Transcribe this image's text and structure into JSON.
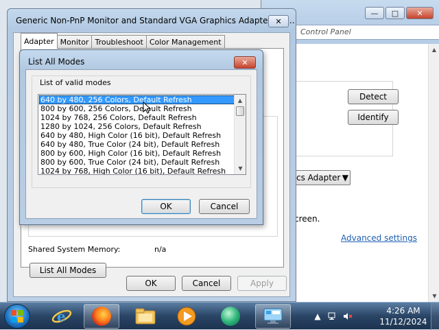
{
  "control_panel": {
    "address": "Control Panel",
    "detect_label": "Detect",
    "identify_label": "Identify",
    "adapter_select_value": "cs Adapter",
    "screen_text": "creen.",
    "advanced_link": "Advanced settings"
  },
  "properties": {
    "title": "Generic Non-PnP Monitor and Standard VGA Graphics Adapter Pro...",
    "close_label": "✕",
    "tabs": [
      {
        "label": "Adapter"
      },
      {
        "label": "Monitor"
      },
      {
        "label": "Troubleshoot"
      },
      {
        "label": "Color Management"
      }
    ],
    "shared_memory_label": "Shared System Memory:",
    "shared_memory_value": "n/a",
    "list_all_modes_label": "List All Modes",
    "ok_label": "OK",
    "cancel_label": "Cancel",
    "apply_label": "Apply"
  },
  "modes_dialog": {
    "title": "List All Modes",
    "close_label": "✕",
    "group_label": "List of valid modes",
    "modes": [
      "640 by 480, 256 Colors, Default Refresh",
      "800 by 600, 256 Colors, Default Refresh",
      "1024 by 768, 256 Colors, Default Refresh",
      "1280 by 1024, 256 Colors, Default Refresh",
      "640 by 480, High Color (16 bit), Default Refresh",
      "640 by 480, True Color (24 bit), Default Refresh",
      "800 by 600, High Color (16 bit), Default Refresh",
      "800 by 600, True Color (24 bit), Default Refresh",
      "1024 by 768, High Color (16 bit), Default Refresh"
    ],
    "ok_label": "OK",
    "cancel_label": "Cancel"
  },
  "taskbar": {
    "time": "4:26 AM",
    "date": "11/12/2024",
    "pinned": [
      {
        "name": "internet-explorer-icon"
      },
      {
        "name": "firefox-icon"
      },
      {
        "name": "file-explorer-icon"
      },
      {
        "name": "media-player-icon"
      },
      {
        "name": "generic-app-icon"
      },
      {
        "name": "display-settings-icon"
      }
    ]
  },
  "colors": {
    "selection": "#3399ff",
    "link": "#1e5fb4",
    "close_red": "#c7432c"
  }
}
